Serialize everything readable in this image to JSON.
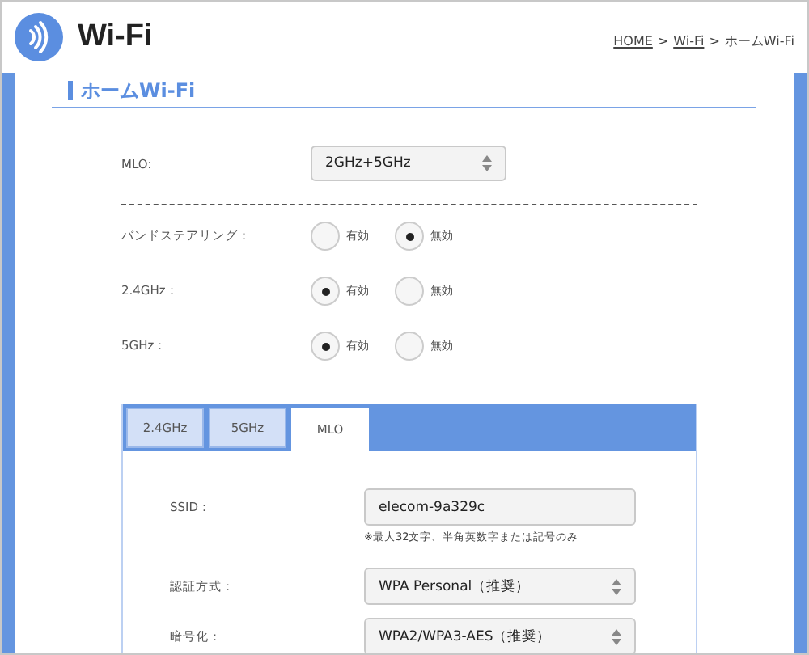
{
  "header": {
    "title": "Wi-Fi",
    "breadcrumb": [
      {
        "label": "HOME",
        "link": true
      },
      {
        "label": ">",
        "link": false
      },
      {
        "label": "Wi-Fi",
        "link": true
      },
      {
        "label": ">",
        "link": false
      },
      {
        "label": "ホームWi-Fi",
        "link": false
      }
    ]
  },
  "section": {
    "title": "ホームWi-Fi"
  },
  "mlo": {
    "label": "MLO:",
    "value": "2GHz+5GHz"
  },
  "radio_rows": [
    {
      "label": "バンドステアリング：",
      "options": [
        {
          "label": "有効",
          "selected": false
        },
        {
          "label": "無効",
          "selected": true
        }
      ]
    },
    {
      "label": "2.4GHz：",
      "options": [
        {
          "label": "有効",
          "selected": true
        },
        {
          "label": "無効",
          "selected": false
        }
      ]
    },
    {
      "label": "5GHz：",
      "options": [
        {
          "label": "有効",
          "selected": true
        },
        {
          "label": "無効",
          "selected": false
        }
      ]
    }
  ],
  "tabs": [
    {
      "label": "2.4GHz",
      "selected": false
    },
    {
      "label": "5GHz",
      "selected": false
    },
    {
      "label": "MLO",
      "selected": true
    }
  ],
  "fields": [
    {
      "kind": "input",
      "label": "SSID：",
      "value": "elecom-9a329c",
      "note": "※最大32文字、半角英数字または記号のみ"
    },
    {
      "kind": "select",
      "label": "認証方式：",
      "value": "WPA Personal（推奨）"
    },
    {
      "kind": "select",
      "label": "暗号化：",
      "value": "WPA2/WPA3-AES（推奨）"
    }
  ]
}
